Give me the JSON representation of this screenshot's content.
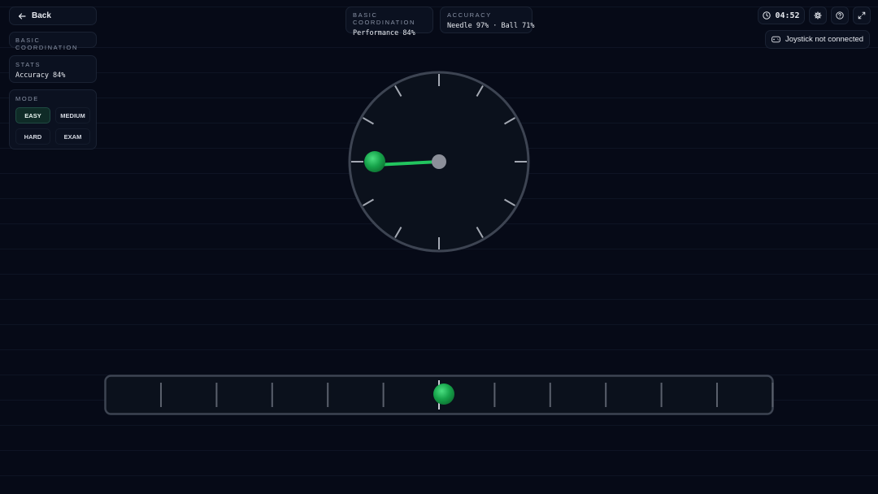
{
  "nav": {
    "back_label": "Back"
  },
  "left": {
    "section_label": "BASIC COORDINATION",
    "stats": {
      "label": "STATS",
      "value": "Accuracy 84%"
    },
    "mode": {
      "label": "MODE",
      "options": [
        "EASY",
        "MEDIUM",
        "HARD",
        "EXAM"
      ],
      "selected": "EASY"
    }
  },
  "top": {
    "coordination": {
      "label": "BASIC COORDINATION",
      "value": "Performance 84%"
    },
    "accuracy": {
      "label": "ACCURACY",
      "value": "Needle 97% · Ball 71%"
    }
  },
  "toolbar": {
    "timer": "04:52",
    "icons": [
      "clock-icon",
      "gear-icon",
      "help-icon",
      "fullscreen-icon"
    ],
    "joystick_status": "Joystick not connected"
  },
  "game": {
    "ball_color": "#22c55e",
    "needle_color": "#22c55e",
    "dial_tick_count": 12,
    "slider_tick_count": 12
  }
}
